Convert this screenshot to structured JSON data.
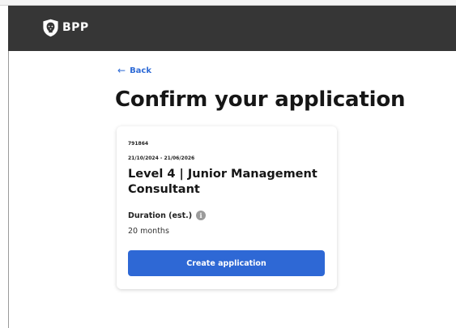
{
  "header": {
    "logo_text": "BPP",
    "logo_icon": "lion-shield-icon",
    "background": "#363636"
  },
  "back": {
    "label": "Back",
    "icon": "arrow-left-icon"
  },
  "page": {
    "title": "Confirm your application"
  },
  "card": {
    "reference": "791864",
    "dates": "21/10/2024 - 21/06/2026",
    "title": "Level 4 | Junior Management Consultant",
    "duration_label": "Duration (est.)",
    "duration_info_icon": "info-icon",
    "duration_value": "20 months",
    "button_label": "Create application"
  },
  "colors": {
    "accent": "#2e68d5",
    "link": "#2f6bd6",
    "header": "#363636"
  }
}
